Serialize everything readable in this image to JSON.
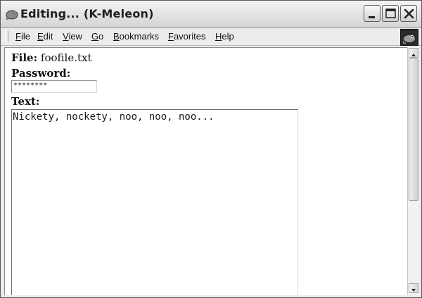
{
  "window": {
    "title": "Editing... (K-Meleon)",
    "icons": {
      "app": "k-meleon-chameleon-icon",
      "minimize": "minimize-icon",
      "maximize": "maximize-icon",
      "close": "close-icon",
      "throbber": "k-meleon-throbber-icon"
    }
  },
  "menubar": {
    "items": [
      {
        "accel": "F",
        "rest": "ile"
      },
      {
        "accel": "E",
        "rest": "dit"
      },
      {
        "accel": "V",
        "rest": "iew"
      },
      {
        "accel": "G",
        "rest": "o"
      },
      {
        "accel": "B",
        "rest": "ookmarks"
      },
      {
        "accel": "F",
        "rest": "avorites"
      },
      {
        "accel": "H",
        "rest": "elp"
      }
    ]
  },
  "form": {
    "file_label": "File:",
    "file_name": "foofile.txt",
    "password_label": "Password:",
    "password_value": "********",
    "text_label": "Text:",
    "text_value": "Nickety, nockety, noo, noo, noo..."
  }
}
